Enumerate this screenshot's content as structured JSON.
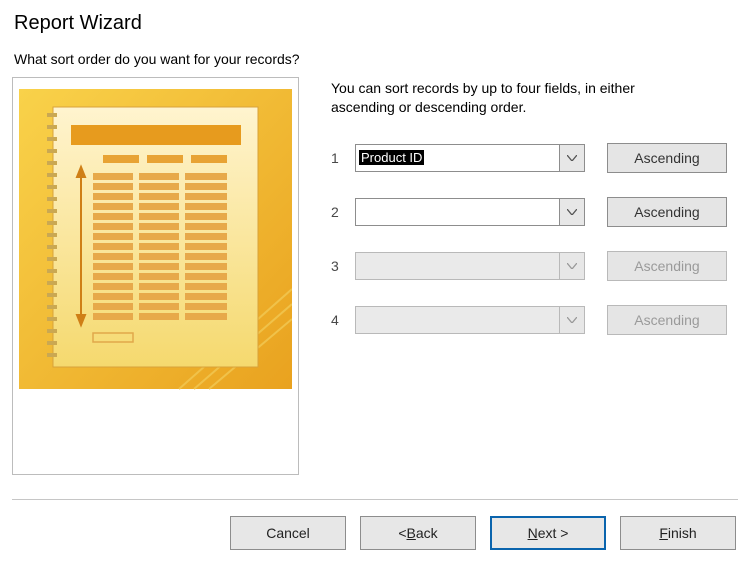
{
  "title": "Report Wizard",
  "question": "What sort order do you want for your records?",
  "instruction_line1": "You can sort records by up to four fields, in either",
  "instruction_line2": "ascending or descending order.",
  "sort_rows": [
    {
      "num": "1",
      "value": "Product ID",
      "enabled": true,
      "order": "Ascending",
      "order_enabled": true,
      "highlight": true
    },
    {
      "num": "2",
      "value": "",
      "enabled": true,
      "order": "Ascending",
      "order_enabled": true,
      "highlight": false
    },
    {
      "num": "3",
      "value": "",
      "enabled": false,
      "order": "Ascending",
      "order_enabled": false,
      "highlight": false
    },
    {
      "num": "4",
      "value": "",
      "enabled": false,
      "order": "Ascending",
      "order_enabled": false,
      "highlight": false
    }
  ],
  "buttons": {
    "cancel": "Cancel",
    "back": "< Back",
    "next": "Next >",
    "finish": "Finish"
  }
}
